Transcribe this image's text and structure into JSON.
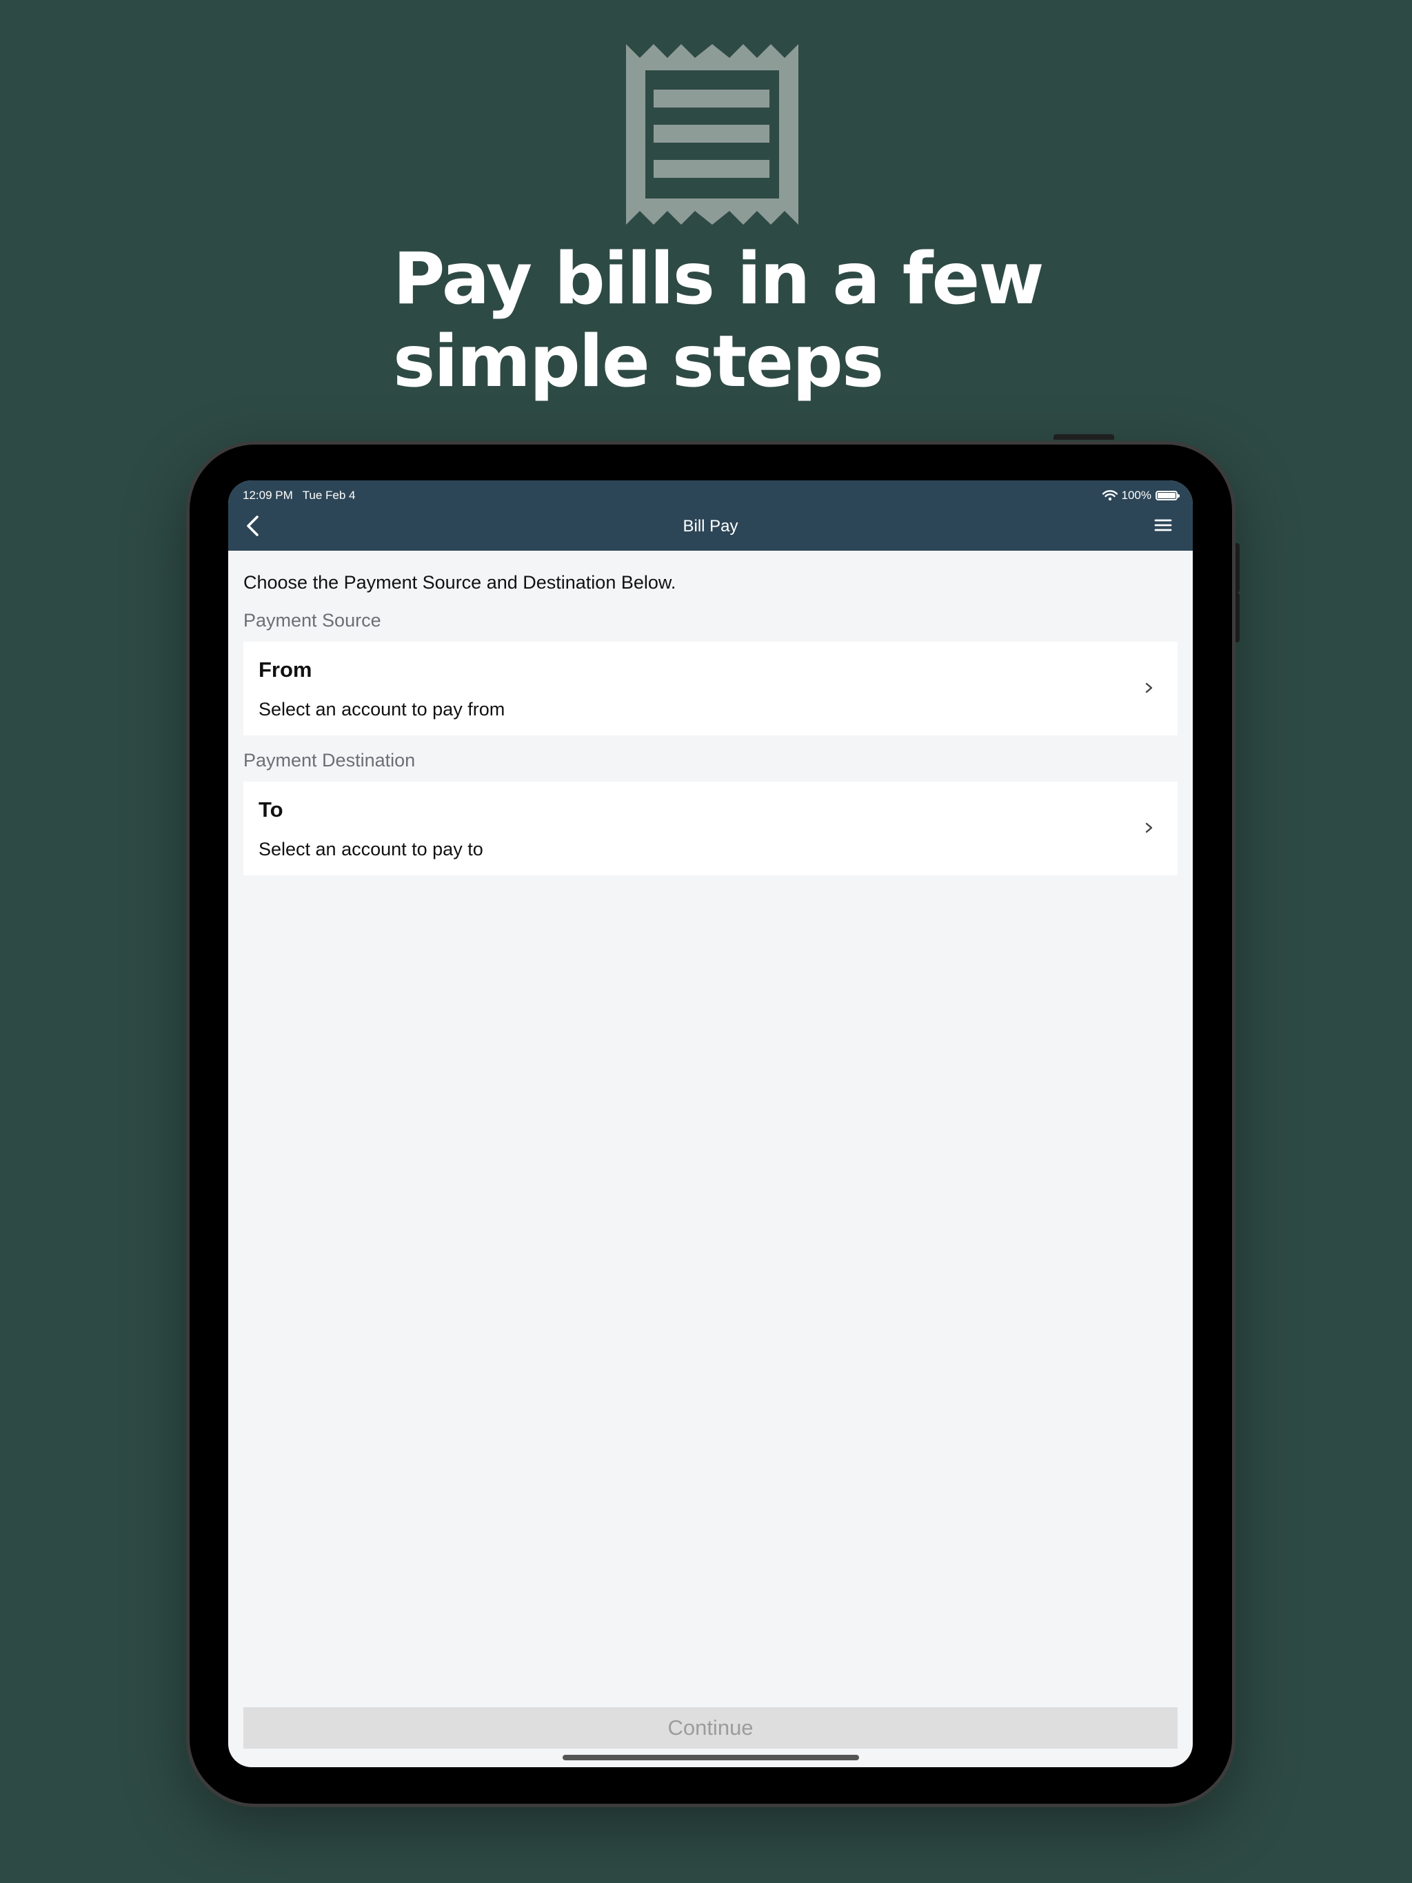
{
  "hero": {
    "icon": "receipt-icon",
    "headline_line1": "Pay bills in a few",
    "headline_line2": "simple steps"
  },
  "status_bar": {
    "time": "12:09 PM",
    "date": "Tue Feb 4",
    "battery": "100%"
  },
  "nav": {
    "title": "Bill Pay",
    "back_icon": "chevron-left-icon",
    "menu_icon": "hamburger-menu-icon"
  },
  "content": {
    "intro": "Choose the Payment Source and Destination Below.",
    "source": {
      "label": "Payment Source",
      "title": "From",
      "subtitle": "Select an account to pay from"
    },
    "destination": {
      "label": "Payment Destination",
      "title": "To",
      "subtitle": "Select an account to pay to"
    },
    "continue_label": "Continue"
  },
  "colors": {
    "background": "#2e4a44",
    "nav_bar": "#2d4657",
    "screen_bg": "#f4f5f7",
    "icon": "#8e9c98",
    "button_disabled": "#dedede"
  }
}
